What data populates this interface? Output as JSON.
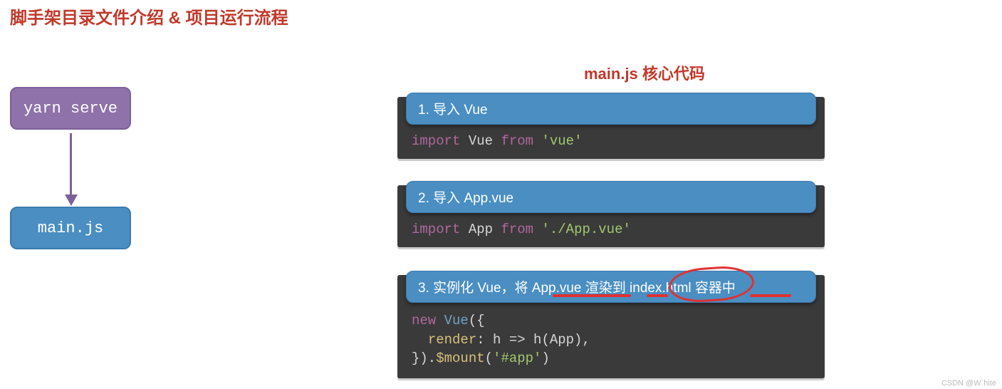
{
  "title": "脚手架目录文件介绍 & 项目运行流程",
  "subtitle": "main.js 核心代码",
  "flow": {
    "step1": "yarn serve",
    "step2": "main.js"
  },
  "cards": {
    "c1": {
      "head": "1. 导入 Vue",
      "code": {
        "kw1": "import",
        "id": "Vue",
        "kw2": "from",
        "str": "'vue'"
      }
    },
    "c2": {
      "head": "2. 导入 App.vue",
      "code": {
        "kw1": "import",
        "id": "App",
        "kw2": "from",
        "str": "'./App.vue'"
      }
    },
    "c3": {
      "head": "3. 实例化 Vue，将 App.vue 渲染到 index.html 容器中",
      "code": {
        "kw_new": "new",
        "cls": "Vue",
        "open": "({",
        "prop": "render",
        "arrow": ": h => h(App),",
        "close": "}).",
        "mount": "$mount",
        "arg": "'#app'",
        "paren": "(",
        "paren2": ")"
      }
    }
  },
  "watermark": "CSDN @W`hite"
}
